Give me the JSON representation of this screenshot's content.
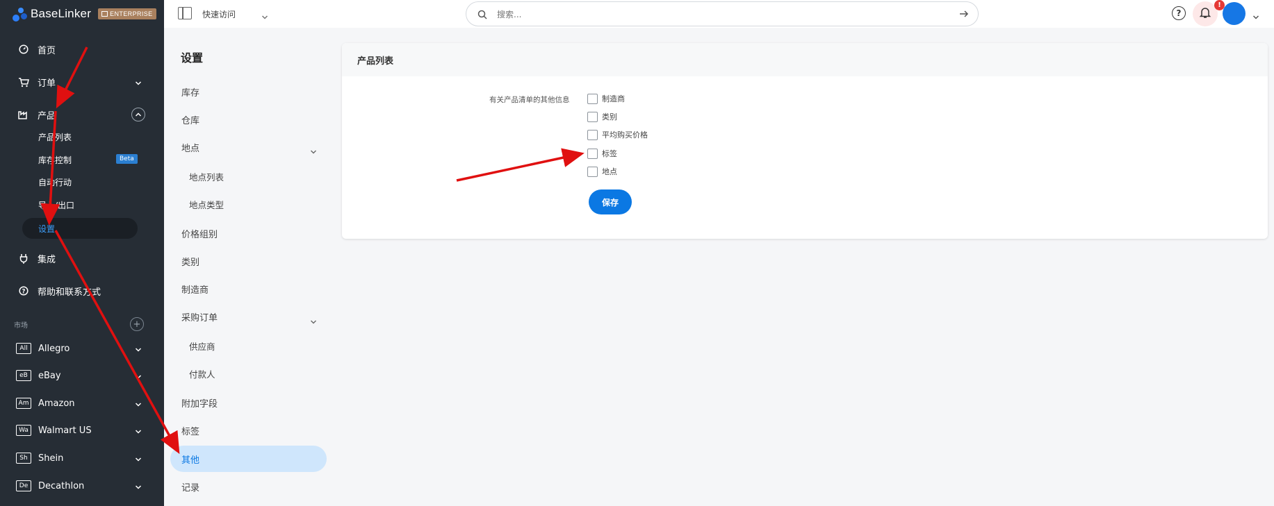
{
  "brand": {
    "name": "BaseLinker",
    "edition": "ENTERPRISE"
  },
  "sidebar": {
    "items": [
      {
        "label": "首页"
      },
      {
        "label": "订单"
      },
      {
        "label": "产品"
      },
      {
        "label": "集成"
      },
      {
        "label": "帮助和联系方式"
      }
    ],
    "product_sub": [
      {
        "label": "产品列表"
      },
      {
        "label": "库存控制",
        "badge": "Beta"
      },
      {
        "label": "自动行动"
      },
      {
        "label": "导入/出口"
      },
      {
        "label": "设置"
      }
    ],
    "market_label": "市场",
    "markets": [
      {
        "abbr": "All",
        "label": "Allegro"
      },
      {
        "abbr": "eB",
        "label": "eBay"
      },
      {
        "abbr": "Am",
        "label": "Amazon"
      },
      {
        "abbr": "Wa",
        "label": "Walmart US"
      },
      {
        "abbr": "Sh",
        "label": "Shein"
      },
      {
        "abbr": "De",
        "label": "Decathlon"
      }
    ]
  },
  "topbar": {
    "quick_access": "快速访问",
    "search_placeholder": "搜索...",
    "alert_count": "!"
  },
  "settings": {
    "title": "设置",
    "items": [
      "库存",
      "仓库",
      "地点",
      "地点列表",
      "地点类型",
      "价格组别",
      "类别",
      "制造商",
      "采购订单",
      "供应商",
      "付款人",
      "附加字段",
      "标签",
      "其他",
      "记录"
    ]
  },
  "card": {
    "title": "产品列表",
    "field_label": "有关产品清单的其他信息",
    "options": [
      {
        "label": "制造商",
        "checked": false
      },
      {
        "label": "类别",
        "checked": false
      },
      {
        "label": "平均购买价格",
        "checked": false
      },
      {
        "label": "标签",
        "checked": false
      },
      {
        "label": "地点",
        "checked": false
      }
    ],
    "save_label": "保存"
  },
  "colors": {
    "sidebar_bg": "#262d35",
    "accent": "#0b78e3",
    "active_bg": "#cfe6fc",
    "arrow": "#e01010"
  }
}
